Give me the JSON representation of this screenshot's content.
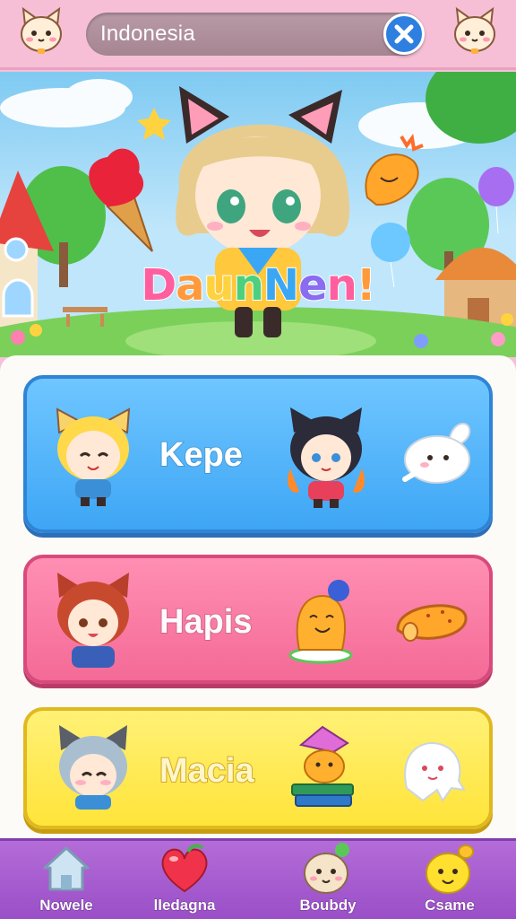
{
  "header": {
    "search": {
      "value": "Indonesia",
      "clear_icon": "close-icon"
    },
    "left_mascot_icon": "cat-mascot-icon",
    "right_mascot_icon": "cat-mascot-icon"
  },
  "hero": {
    "logo_text": "DaunNen!",
    "logo_colors": [
      "#ff5f9e",
      "#ff9a3c",
      "#ffd23f",
      "#4cd07d",
      "#3aa7f5",
      "#8a6cf2",
      "#ff5f9e",
      "#ff9a3c"
    ]
  },
  "cards": [
    {
      "label": "Kepe",
      "color": "#4fb3fb",
      "icons": [
        "blonde-cat-girl-icon",
        "dark-hair-cat-girl-icon",
        "bunny-icon"
      ]
    },
    {
      "label": "Hapis",
      "color": "#f87aa3",
      "icons": [
        "red-hair-cat-girl-icon",
        "mango-character-icon",
        "bread-icon"
      ]
    },
    {
      "label": "Macia",
      "color": "#ffe84a",
      "icons": [
        "silver-hair-cat-girl-icon",
        "books-character-icon",
        "ghost-icon"
      ]
    }
  ],
  "bottom_nav": [
    {
      "label": "Nowele",
      "icon": "home-icon"
    },
    {
      "label": "lledagna",
      "icon": "heart-icon"
    },
    {
      "label": "Boubdy",
      "icon": "onion-character-icon"
    },
    {
      "label": "Csame",
      "icon": "lemon-character-icon"
    }
  ]
}
